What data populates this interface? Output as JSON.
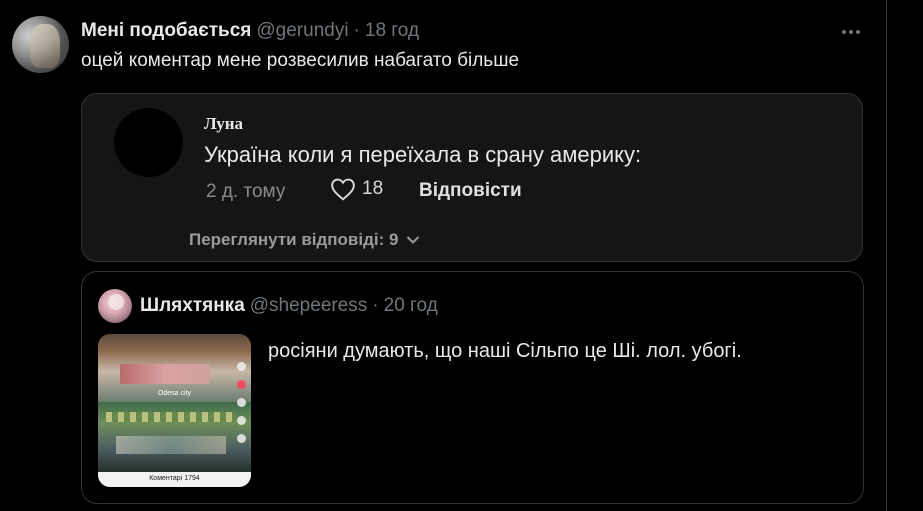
{
  "tweet": {
    "display_name": "Мені подобається",
    "handle": "@gerundyi",
    "separator": "·",
    "time": "18 год",
    "text": "оцей коментар мене розвесилив набагато більше"
  },
  "embedded_comment": {
    "author": "Луна",
    "text": "Україна коли я переїхала в срану америку:",
    "age": "2 д. тому",
    "likes": "18",
    "reply_label": "Відповісти",
    "view_replies": "Переглянути відповіді: 9"
  },
  "quoted_tweet": {
    "display_name": "Шляхтянка",
    "handle": "@shepeeress",
    "separator": "·",
    "time": "20 год",
    "text": "росіяни думають, що наші Сільпо це Ші. лол. убогі.",
    "media": {
      "caption": "Odesa city",
      "comments": "Коментарі 1794"
    }
  },
  "icons": {
    "more": "more-horizontal-icon",
    "like": "heart-outline-icon",
    "chevron": "chevron-down-icon"
  },
  "colors": {
    "background": "#000000",
    "text_primary": "#e7e9ea",
    "text_secondary": "#71767b",
    "border": "#2f3336",
    "embed_bg": "#151515"
  }
}
